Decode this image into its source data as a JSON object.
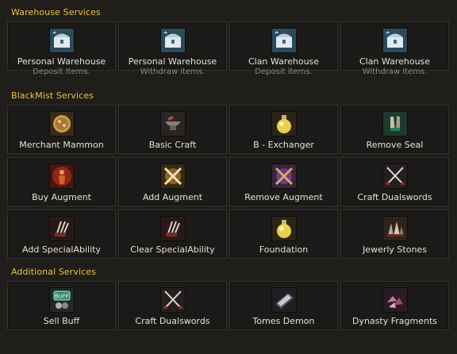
{
  "sections": {
    "warehouse": {
      "title": "Warehouse Services",
      "items": [
        {
          "label": "Personal Warehouse",
          "sub": "Deposit Items.",
          "icon": "warehouse-chest-icon"
        },
        {
          "label": "Personal Warehouse",
          "sub": "Withdraw items.",
          "icon": "warehouse-chest-icon"
        },
        {
          "label": "Clan Warehouse",
          "sub": "Deposit items.",
          "icon": "warehouse-chest-icon"
        },
        {
          "label": "Clan Warehouse",
          "sub": "Withdraw items.",
          "icon": "warehouse-chest-icon"
        }
      ]
    },
    "blackmist": {
      "title": "BlackMist Services",
      "items": [
        {
          "label": "Merchant Mammon",
          "icon": "gold-coin-icon"
        },
        {
          "label": "Basic Craft",
          "icon": "anvil-icon"
        },
        {
          "label": "B - Exchanger",
          "icon": "potion-flask-icon"
        },
        {
          "label": "Remove Seal",
          "icon": "sealed-gloves-icon"
        },
        {
          "label": "Buy Augment",
          "icon": "red-flame-figure-icon"
        },
        {
          "label": "Add Augment",
          "icon": "crossed-swords-glow-icon"
        },
        {
          "label": "Remove Augment",
          "icon": "crossed-swords-purple-icon"
        },
        {
          "label": "Craft Dualswords",
          "icon": "dual-swords-icon"
        },
        {
          "label": "Add SpecialAbility",
          "icon": "claw-weapon-icon"
        },
        {
          "label": "Clear SpecialAbility",
          "icon": "claw-weapon-icon"
        },
        {
          "label": "Foundation",
          "icon": "potion-flask-icon"
        },
        {
          "label": "Jewerly Stones",
          "icon": "stone-shards-icon"
        }
      ]
    },
    "additional": {
      "title": "Additional Services",
      "items": [
        {
          "label": "Sell Buff",
          "icon": "buff-sign-icon"
        },
        {
          "label": "Craft Dualswords",
          "icon": "dual-swords-icon"
        },
        {
          "label": "Tomes Demon",
          "icon": "tome-book-icon"
        },
        {
          "label": "Dynasty Fragments",
          "icon": "dynasty-fragments-icon"
        }
      ]
    }
  },
  "buff_icon_text": "BUFF",
  "colors": {
    "section_title": "#e8c33a",
    "label": "#e4e1d8",
    "sub_label": "#8c8a84",
    "tile_border": "#34332f",
    "background": "#1f1e1b"
  }
}
